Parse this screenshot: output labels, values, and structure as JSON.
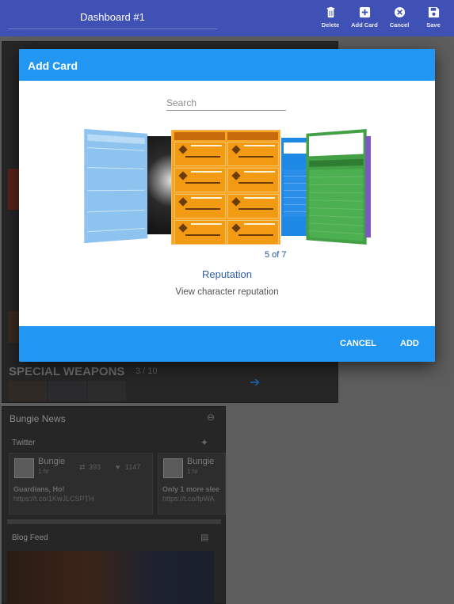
{
  "app_bar": {
    "title": "Dashboard #1",
    "actions": [
      {
        "label": "Delete",
        "icon": "trash-icon"
      },
      {
        "label": "Add Card",
        "icon": "add-box-icon"
      },
      {
        "label": "Cancel",
        "icon": "cancel-circle-icon"
      },
      {
        "label": "Save",
        "icon": "save-floppy-icon"
      }
    ]
  },
  "background": {
    "special_weapons_title": "SPECIAL WEAPONS",
    "special_weapons_count": "3 / 10",
    "bungie_news_title": "Bungie News",
    "twitter_title": "Twitter",
    "tweets": [
      {
        "author": "Bungie",
        "time": "1 hr",
        "retweets": "393",
        "likes": "1147",
        "text": "Guardians, Ho!",
        "link": "https://t.co/1KwJLCSPTH"
      },
      {
        "author": "Bungie",
        "time": "1 hr",
        "text": "Only 1 more slee",
        "link": "https://t.co/fpWA"
      }
    ],
    "blog_feed_title": "Blog Feed"
  },
  "modal": {
    "title": "Add Card",
    "search_placeholder": "Search",
    "counter": "5 of 7",
    "card_name": "Reputation",
    "card_description": "View character reputation",
    "cancel_label": "CANCEL",
    "add_label": "ADD"
  },
  "colors": {
    "app_bar": "#3f51b5",
    "modal_accent": "#2196f3",
    "reputation_orange": "#f29a12",
    "stats_green": "#4caf50"
  }
}
